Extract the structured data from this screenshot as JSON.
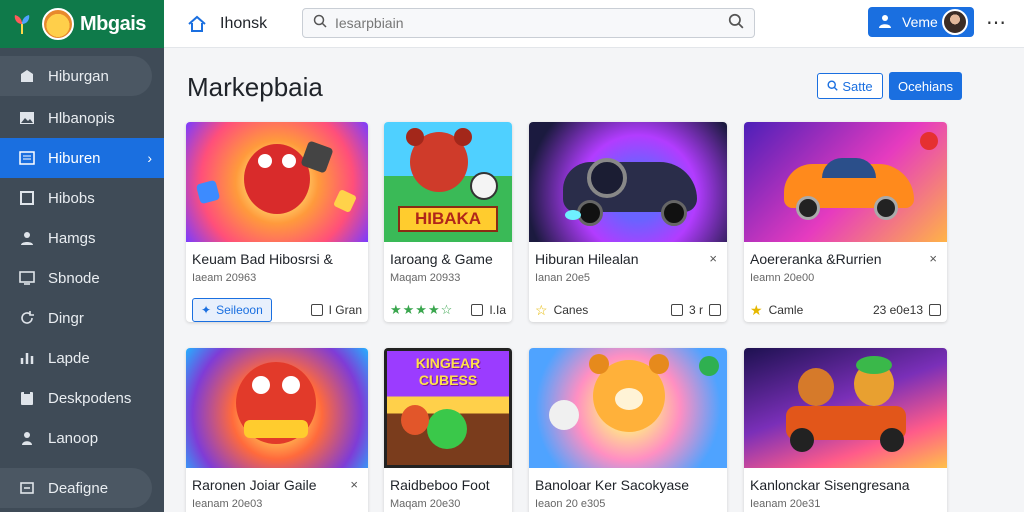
{
  "brand": {
    "name": "Mbgais"
  },
  "sidebar": {
    "items": [
      {
        "label": "Hiburgan",
        "icon": "store-icon"
      },
      {
        "label": "Hlbanopis",
        "icon": "image-icon"
      },
      {
        "label": "Hiburen",
        "icon": "list-icon"
      },
      {
        "label": "Hibobs",
        "icon": "box-icon"
      },
      {
        "label": "Hamgs",
        "icon": "user-icon"
      },
      {
        "label": "Sbnode",
        "icon": "monitor-icon"
      },
      {
        "label": "Dingr",
        "icon": "refresh-icon"
      },
      {
        "label": "Lapde",
        "icon": "chart-icon"
      },
      {
        "label": "Deskpodens",
        "icon": "clipboard-icon"
      },
      {
        "label": "Lanoop",
        "icon": "person-icon"
      },
      {
        "label": "Deafigne",
        "icon": "settings-icon"
      }
    ]
  },
  "header": {
    "title": "Ihonsk",
    "search_placeholder": "Iesarpbiain",
    "user_label": "Veme"
  },
  "main": {
    "title": "Markepbaia",
    "btn_outline": "Satte",
    "btn_solid": "Ocehians"
  },
  "cards": [
    {
      "title": "Keuam Bad Hibosrsi &",
      "subtitle": "Iaeam 20963",
      "foot_left": "Seileoon",
      "foot_right": "I Gran"
    },
    {
      "title": "Iaroang & Game",
      "subtitle": "Maqam 20933",
      "foot_left": "★★★★☆",
      "foot_right": "I.Ia",
      "banner": "HIBAKA"
    },
    {
      "title": "Hiburan Hilealan",
      "subtitle": "Ianan 20e5",
      "foot_left": "Canes",
      "foot_right": "3 r",
      "close": "×"
    },
    {
      "title": "Aoereranka &Rurrien",
      "subtitle": "Ieamn 20e00",
      "foot_left": "Camle",
      "foot_right": "23 e0e13",
      "close": "×"
    },
    {
      "title": "Raronen Joiar Gaile",
      "subtitle": "Ieanam 20e03",
      "close": "×"
    },
    {
      "title": "Raidbeboo Foot",
      "subtitle": "Maqam 20e30",
      "banner": "KINGEAR CUBESS"
    },
    {
      "title": "Banoloar Ker Sacokyase",
      "subtitle": "Ieaon 20 e305"
    },
    {
      "title": "Kanlonckar Sisengresana",
      "subtitle": "Ieanam 20e31"
    }
  ],
  "colors": {
    "accent": "#1a6fe0",
    "brand_bg": "#0f7a4a",
    "sidebar_bg": "#3f4b57"
  }
}
